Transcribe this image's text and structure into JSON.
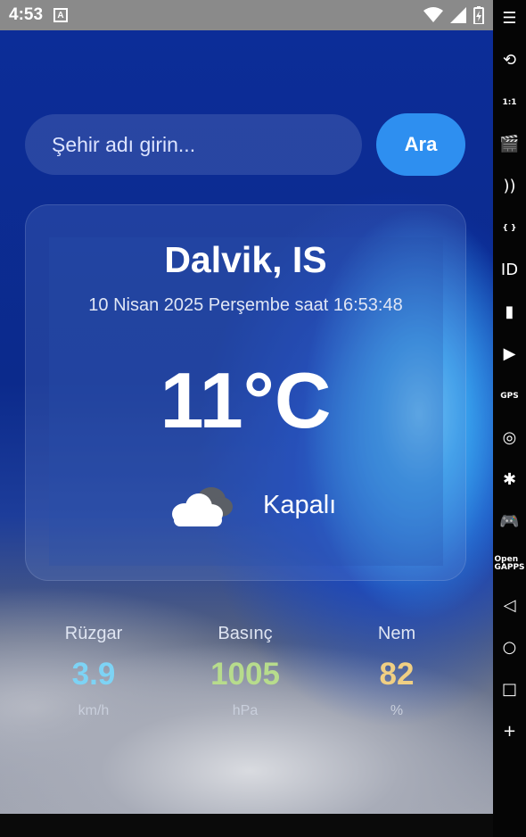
{
  "status_bar": {
    "time": "4:53",
    "notification_icon": "accessibility-icon",
    "icons": [
      "wifi-icon",
      "signal-icon",
      "battery-charging-icon"
    ]
  },
  "search": {
    "placeholder": "Şehir adı girin...",
    "value": "",
    "button_label": "Ara"
  },
  "weather": {
    "city": "Dalvik, IS",
    "datetime": "10 Nisan 2025 Perşembe saat 16:53:48",
    "temperature": "11°C",
    "condition": "Kapalı",
    "condition_icon": "overcast-cloud-icon"
  },
  "stats": [
    {
      "label": "Rüzgar",
      "value": "3.9",
      "unit": "km/h",
      "color": "#7dd3f5"
    },
    {
      "label": "Basınç",
      "value": "1005",
      "unit": "hPa",
      "color": "#b7dc8c"
    },
    {
      "label": "Nem",
      "value": "82",
      "unit": "%",
      "color": "#f0cf83"
    }
  ],
  "emulator_sidebar": {
    "items": [
      {
        "icon": "menu-icon",
        "glyph": "☰"
      },
      {
        "icon": "rotate-icon",
        "glyph": "⟲"
      },
      {
        "icon": "pixel-perfect-icon",
        "glyph": "1:1"
      },
      {
        "icon": "screen-record-icon",
        "glyph": "🎬"
      },
      {
        "icon": "cast-icon",
        "glyph": "))"
      },
      {
        "icon": "code-braces-icon",
        "glyph": "{ }"
      },
      {
        "icon": "device-id-icon",
        "glyph": "ID"
      },
      {
        "icon": "sim-card-icon",
        "glyph": "▮"
      },
      {
        "icon": "media-icon",
        "glyph": "▶"
      },
      {
        "icon": "gps-icon",
        "glyph": "GPS"
      },
      {
        "icon": "fingerprint-icon",
        "glyph": "◎"
      },
      {
        "icon": "network-icon",
        "glyph": "✱"
      },
      {
        "icon": "gamepad-icon",
        "glyph": "🎮"
      },
      {
        "icon": "opengapps-icon",
        "glyph": "Open GAPPS"
      },
      {
        "icon": "back-icon",
        "glyph": "◁"
      },
      {
        "icon": "home-icon",
        "glyph": "○"
      },
      {
        "icon": "recents-icon",
        "glyph": "□"
      },
      {
        "icon": "add-icon",
        "glyph": "+"
      }
    ]
  }
}
